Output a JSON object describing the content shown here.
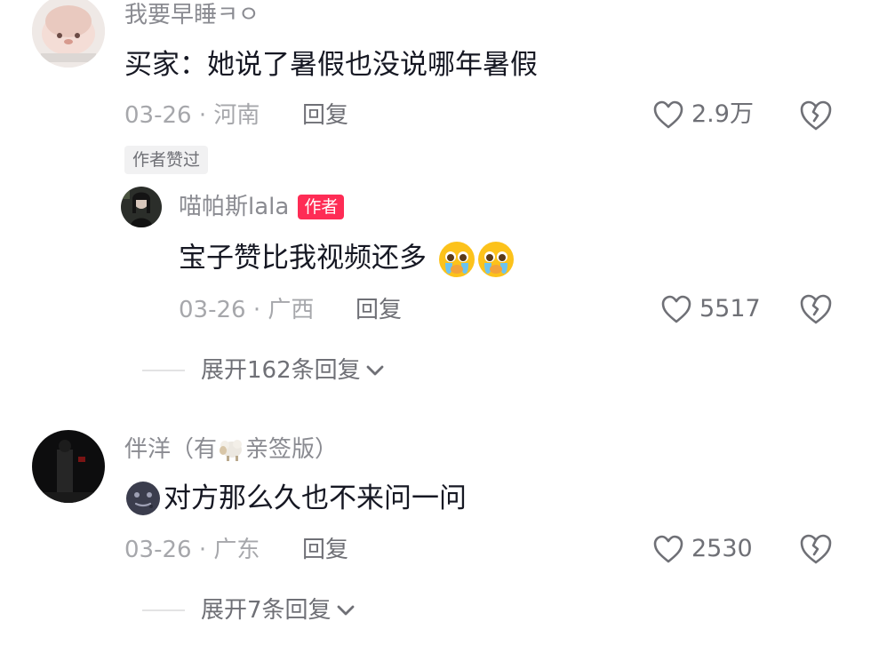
{
  "comments": [
    {
      "username": "我要早睡ㅋㅇ",
      "text": "买家：她说了暑假也没说哪年暑假",
      "date": "03-26",
      "location": "河南",
      "reply_label": "回复",
      "likes": "2.9万",
      "author_liked_tag": "作者赞过",
      "reply": {
        "username": "喵帕斯lala",
        "author_tag": "作者",
        "text": "宝子赞比我视频还多",
        "date": "03-26",
        "location": "广西",
        "reply_label": "回复",
        "likes": "5517"
      },
      "expand_label": "展开162条回复"
    },
    {
      "username_prefix": "伴洋（有",
      "username_suffix": "亲签版）",
      "text": "对方那么久也不来问一问",
      "date": "03-26",
      "location": "广东",
      "reply_label": "回复",
      "likes": "2530",
      "expand_label": "展开7条回复"
    }
  ],
  "separator": " · ",
  "colors": {
    "author_tag": "#fe2c55",
    "meta": "#a6a7ab"
  }
}
